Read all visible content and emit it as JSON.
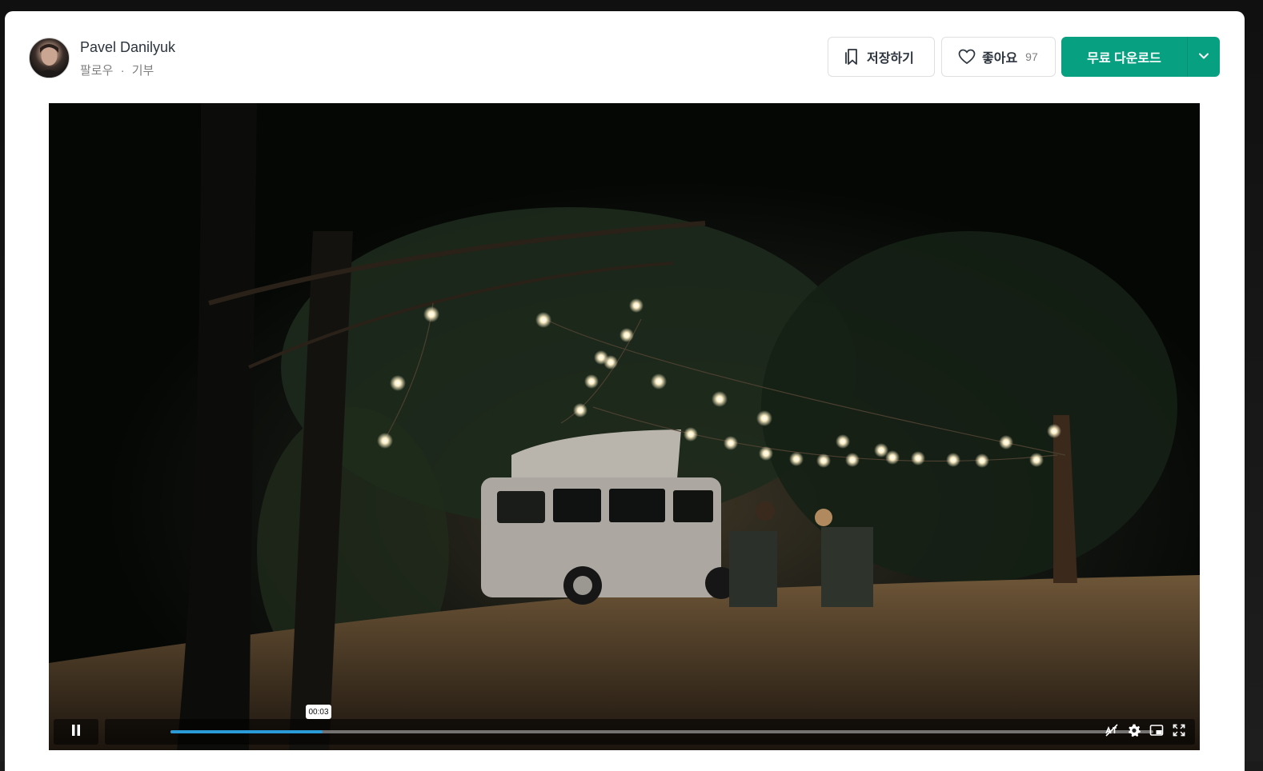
{
  "author": {
    "name": "Pavel Danilyuk",
    "follow_label": "팔로우",
    "separator": "·",
    "donate_label": "기부"
  },
  "actions": {
    "save_label": "저장하기",
    "like_label": "좋아요",
    "like_count": "97",
    "download_label": "무료 다운로드"
  },
  "player": {
    "time_tooltip": "00:03",
    "progress": 0.155,
    "accent_color": "#2b9bd8"
  },
  "colors": {
    "download_green": "#07a081",
    "text_dark": "#2c343e",
    "text_muted": "#7f7f7f"
  },
  "icons": [
    "bookmark-icon",
    "heart-icon",
    "chevron-down-icon",
    "pause-icon",
    "captions-off-icon",
    "gear-icon",
    "picture-in-picture-icon",
    "fullscreen-icon"
  ]
}
